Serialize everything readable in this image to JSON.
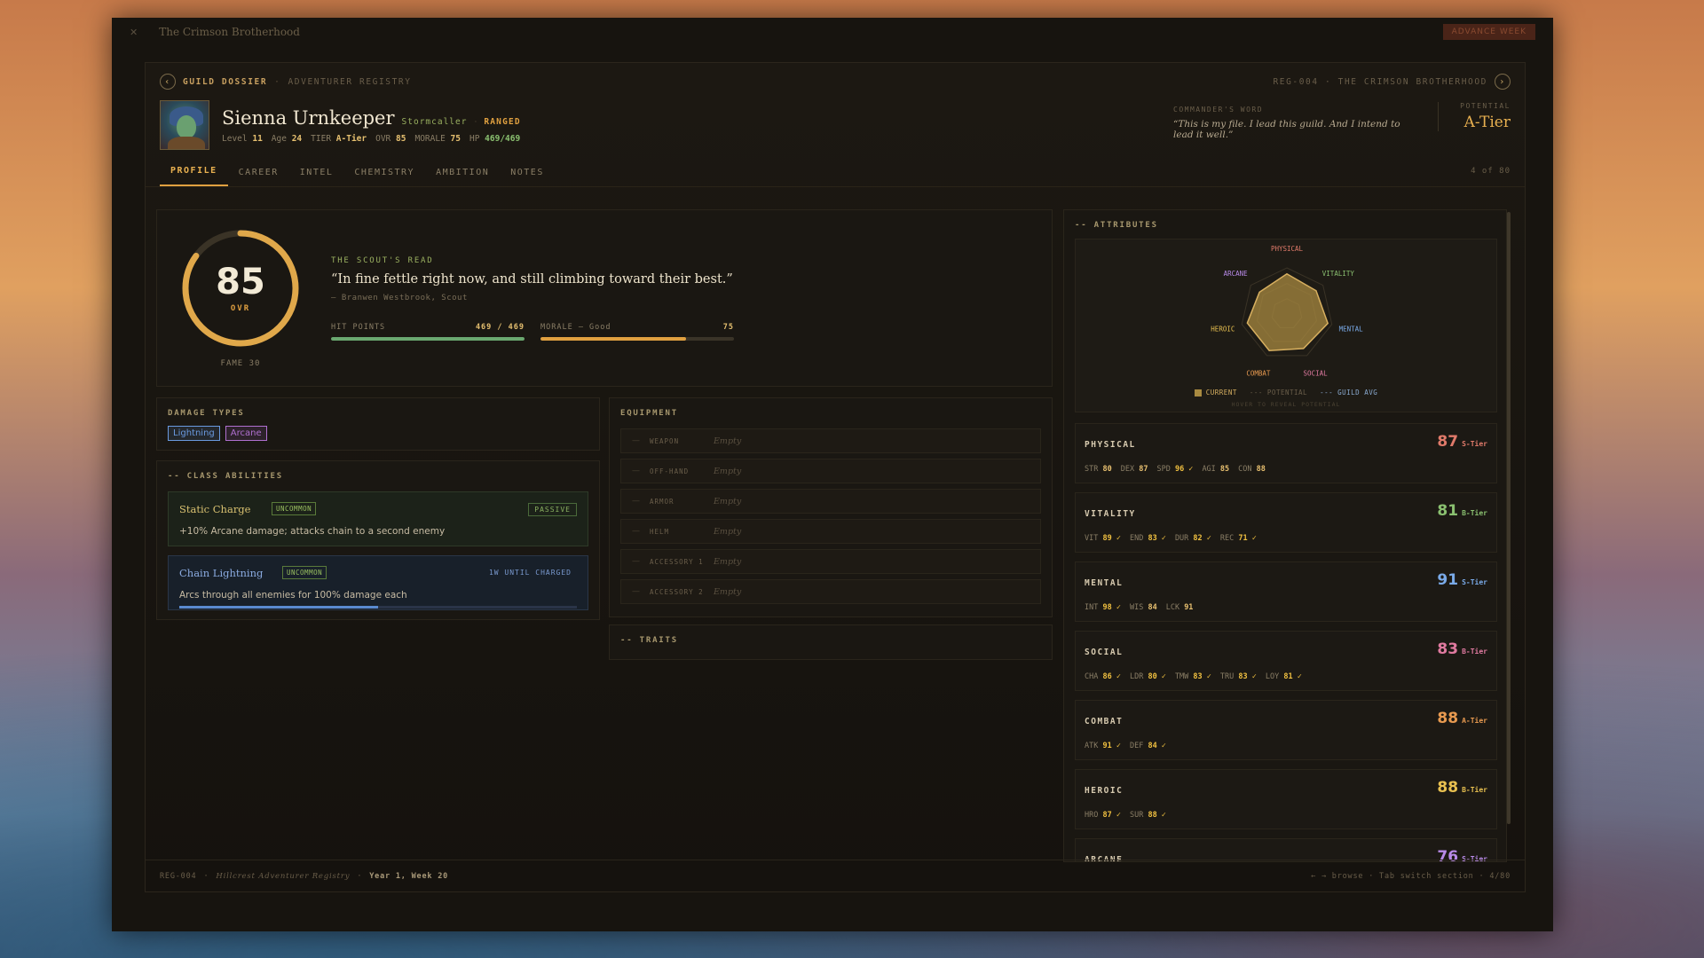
{
  "app": {
    "title": "The Crimson Brotherhood",
    "advance_label": "ADVANCE WEEK"
  },
  "crumbs": {
    "main": "GUILD DOSSIER",
    "sub": "ADVENTURER REGISTRY",
    "right": "REG-004 · THE CRIMSON BROTHERHOOD"
  },
  "hero": {
    "name": "Sienna Urnkeeper",
    "class": "Stormcaller",
    "role": "RANGED",
    "level_label": "Level",
    "level": "11",
    "age_label": "Age",
    "age": "24",
    "tier_label": "TIER",
    "tier": "A-Tier",
    "ovr_label": "OVR",
    "ovr": "85",
    "morale_label": "MORALE",
    "morale": "75",
    "hp_label": "HP",
    "hp": "469/469"
  },
  "commander": {
    "label": "COMMANDER'S WORD",
    "quote": "“This is my file. I lead this guild. And I intend to lead it well.”"
  },
  "potential": {
    "label": "POTENTIAL",
    "value": "A-Tier"
  },
  "tabs": [
    {
      "label": "PROFILE",
      "active": true
    },
    {
      "label": "CAREER"
    },
    {
      "label": "INTEL"
    },
    {
      "label": "CHEMISTRY"
    },
    {
      "label": "AMBITION"
    },
    {
      "label": "NOTES"
    }
  ],
  "tab_count": "4 of 80",
  "overview": {
    "ovr": "85",
    "ovr_label": "OVR",
    "ovr_fraction": 0.85,
    "fame": "FAME 30",
    "scout_label": "THE SCOUT'S READ",
    "scout_quote": "“In fine fettle right now, and still climbing toward their best.”",
    "scout_by": "— Branwen Westbrook, Scout",
    "hp_label": "HIT POINTS",
    "hp_value": "469 / 469",
    "hp_fraction": 1.0,
    "hp_color": "#6aa870",
    "morale_label": "MORALE — Good",
    "morale_value": "75",
    "morale_fraction": 0.75,
    "morale_color": "#e0a040"
  },
  "damage": {
    "label": "DAMAGE TYPES",
    "types": [
      {
        "label": "Lightning",
        "color": "#6a9ae0"
      },
      {
        "label": "Arcane",
        "color": "#b070d0"
      }
    ]
  },
  "abilities": {
    "label": "-- CLASS ABILITIES",
    "items": [
      {
        "name": "Static Charge",
        "rarity": "UNCOMMON",
        "tag": "PASSIVE",
        "desc": "+10% Arcane damage; attacks chain to a second enemy"
      },
      {
        "name": "Chain Lightning",
        "rarity": "UNCOMMON",
        "tag": "1W UNTIL CHARGED",
        "desc": "Arcs through all enemies for 100% damage each",
        "charge_fraction": 0.5
      }
    ]
  },
  "equipment": {
    "label": "EQUIPMENT",
    "slots": [
      {
        "label": "WEAPON",
        "value": "Empty"
      },
      {
        "label": "OFF-HAND",
        "value": "Empty"
      },
      {
        "label": "ARMOR",
        "value": "Empty"
      },
      {
        "label": "HELM",
        "value": "Empty"
      },
      {
        "label": "ACCESSORY 1",
        "value": "Empty"
      },
      {
        "label": "ACCESSORY 2",
        "value": "Empty"
      }
    ]
  },
  "traits": {
    "label": "-- TRAITS"
  },
  "attributes": {
    "label": "-- ATTRIBUTES",
    "radar_axes": [
      "PHYSICAL",
      "VITALITY",
      "MENTAL",
      "SOCIAL",
      "COMBAT",
      "HEROIC",
      "ARCANE"
    ],
    "legend": {
      "current": "CURRENT",
      "potential": "POTENTIAL",
      "guild_avg": "GUILD AVG"
    },
    "hover_hint": "HOVER TO REVEAL POTENTIAL",
    "groups": [
      {
        "name": "PHYSICAL",
        "score": "87",
        "tier": "S-Tier",
        "color": "#e07a6a",
        "stats": [
          {
            "k": "STR",
            "v": "80"
          },
          {
            "k": "DEX",
            "v": "87"
          },
          {
            "k": "SPD",
            "v": "96 ✓",
            "hi": true
          },
          {
            "k": "AGI",
            "v": "85"
          },
          {
            "k": "CON",
            "v": "88"
          }
        ]
      },
      {
        "name": "VITALITY",
        "score": "81",
        "tier": "B-Tier",
        "color": "#8ac070",
        "stats": [
          {
            "k": "VIT",
            "v": "89 ✓",
            "hi": true
          },
          {
            "k": "END",
            "v": "83 ✓",
            "hi": true
          },
          {
            "k": "DUR",
            "v": "82 ✓",
            "hi": true
          },
          {
            "k": "REC",
            "v": "71 ✓",
            "hi": true
          }
        ]
      },
      {
        "name": "MENTAL",
        "score": "91",
        "tier": "S-Tier",
        "color": "#7aaae8",
        "stats": [
          {
            "k": "INT",
            "v": "98 ✓",
            "hi": true
          },
          {
            "k": "WIS",
            "v": "84"
          },
          {
            "k": "LCK",
            "v": "91"
          }
        ]
      },
      {
        "name": "SOCIAL",
        "score": "83",
        "tier": "B-Tier",
        "color": "#e07aa0",
        "stats": [
          {
            "k": "CHA",
            "v": "86 ✓",
            "hi": true
          },
          {
            "k": "LDR",
            "v": "80 ✓",
            "hi": true
          },
          {
            "k": "TMW",
            "v": "83 ✓",
            "hi": true
          },
          {
            "k": "TRU",
            "v": "83 ✓",
            "hi": true
          },
          {
            "k": "LOY",
            "v": "81 ✓",
            "hi": true
          }
        ]
      },
      {
        "name": "COMBAT",
        "score": "88",
        "tier": "A-Tier",
        "color": "#e89a50",
        "stats": [
          {
            "k": "ATK",
            "v": "91 ✓",
            "hi": true
          },
          {
            "k": "DEF",
            "v": "84 ✓",
            "hi": true
          }
        ]
      },
      {
        "name": "HEROIC",
        "score": "88",
        "tier": "B-Tier",
        "color": "#e8c050",
        "stats": [
          {
            "k": "HRO",
            "v": "87 ✓",
            "hi": true
          },
          {
            "k": "SUR",
            "v": "88 ✓",
            "hi": true
          }
        ]
      },
      {
        "name": "ARCANE",
        "score": "76",
        "tier": "S-Tier",
        "color": "#b88ae8",
        "stats": []
      }
    ]
  },
  "footer": {
    "reg": "REG-004",
    "registry": "Hillcrest Adventurer Registry",
    "date": "Year 1, Week 20",
    "hint": "← → browse · Tab switch section · 4/80"
  }
}
